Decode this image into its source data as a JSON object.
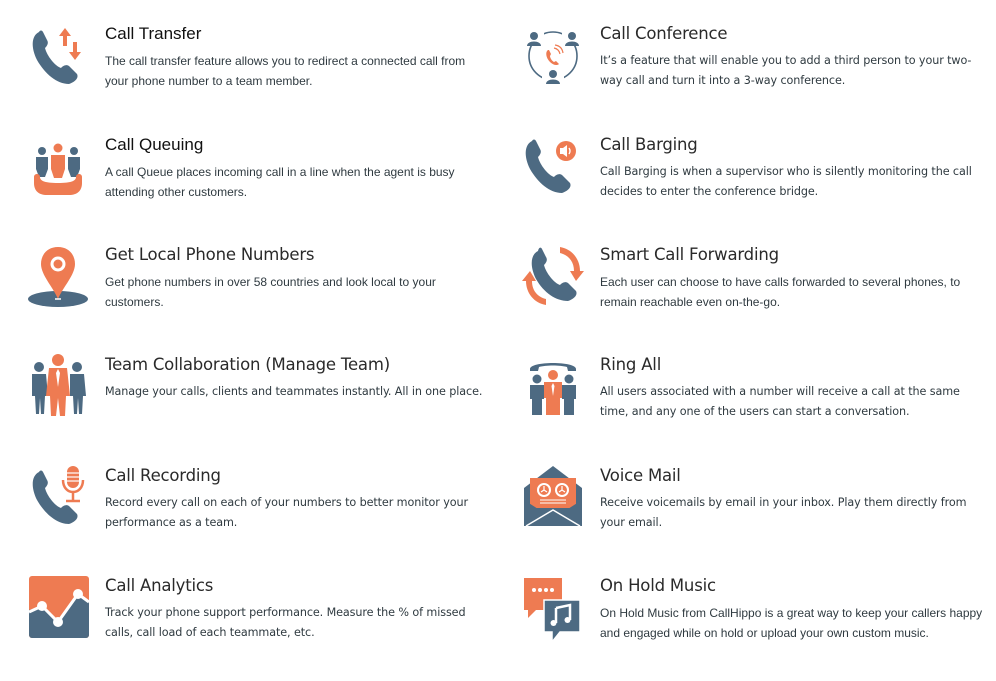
{
  "colors": {
    "primary_blue": "#4d6a82",
    "accent_orange": "#ee7b52",
    "text": "#2f3a40"
  },
  "features": [
    {
      "icon": "phone-transfer-icon",
      "title": "Call Transfer",
      "description": "The call transfer feature allows you to redirect a connected call from your phone number to a team member."
    },
    {
      "icon": "conference-icon",
      "title": "Call Conference",
      "description": "It’s a feature that will enable you to add a third person to your two-way call and turn it into a 3-way conference."
    },
    {
      "icon": "queue-icon",
      "title": "Call Queuing",
      "description": "A call Queue places incoming call in a line when the agent is busy attending other customers."
    },
    {
      "icon": "phone-speaker-icon",
      "title": "Call Barging",
      "description": "Call Barging is when a supervisor who is silently monitoring the call decides to enter the conference bridge."
    },
    {
      "icon": "location-pin-icon",
      "title": "Get Local Phone Numbers",
      "description": "Get phone numbers in over 58 countries and look local to your customers."
    },
    {
      "icon": "phone-forward-icon",
      "title": "Smart Call Forwarding",
      "description": "Each user can choose to have calls forwarded to several phones, to remain reachable even on-the-go."
    },
    {
      "icon": "team-icon",
      "title": "Team Collaboration (Manage Team)",
      "description": "Manage your calls, clients and teammates instantly. All in one place."
    },
    {
      "icon": "ring-all-icon",
      "title": "Ring All",
      "description": "All users associated with a number will receive a call at the same time, and any one of the users can start a conversation."
    },
    {
      "icon": "phone-microphone-icon",
      "title": "Call Recording",
      "description": "Record every call on each of your numbers to better monitor your performance as a team."
    },
    {
      "icon": "voicemail-envelope-icon",
      "title": "Voice Mail",
      "description": "Receive voicemails by email in your inbox. Play them directly from your email."
    },
    {
      "icon": "analytics-chart-icon",
      "title": "Call Analytics",
      "description": "Track your phone support performance. Measure the % of missed calls, call load of each teammate, etc."
    },
    {
      "icon": "music-chat-icon",
      "title": "On Hold Music",
      "description": "On Hold Music from CallHippo is a great way to keep your callers happy and engaged while on hold or upload your own custom music."
    }
  ]
}
